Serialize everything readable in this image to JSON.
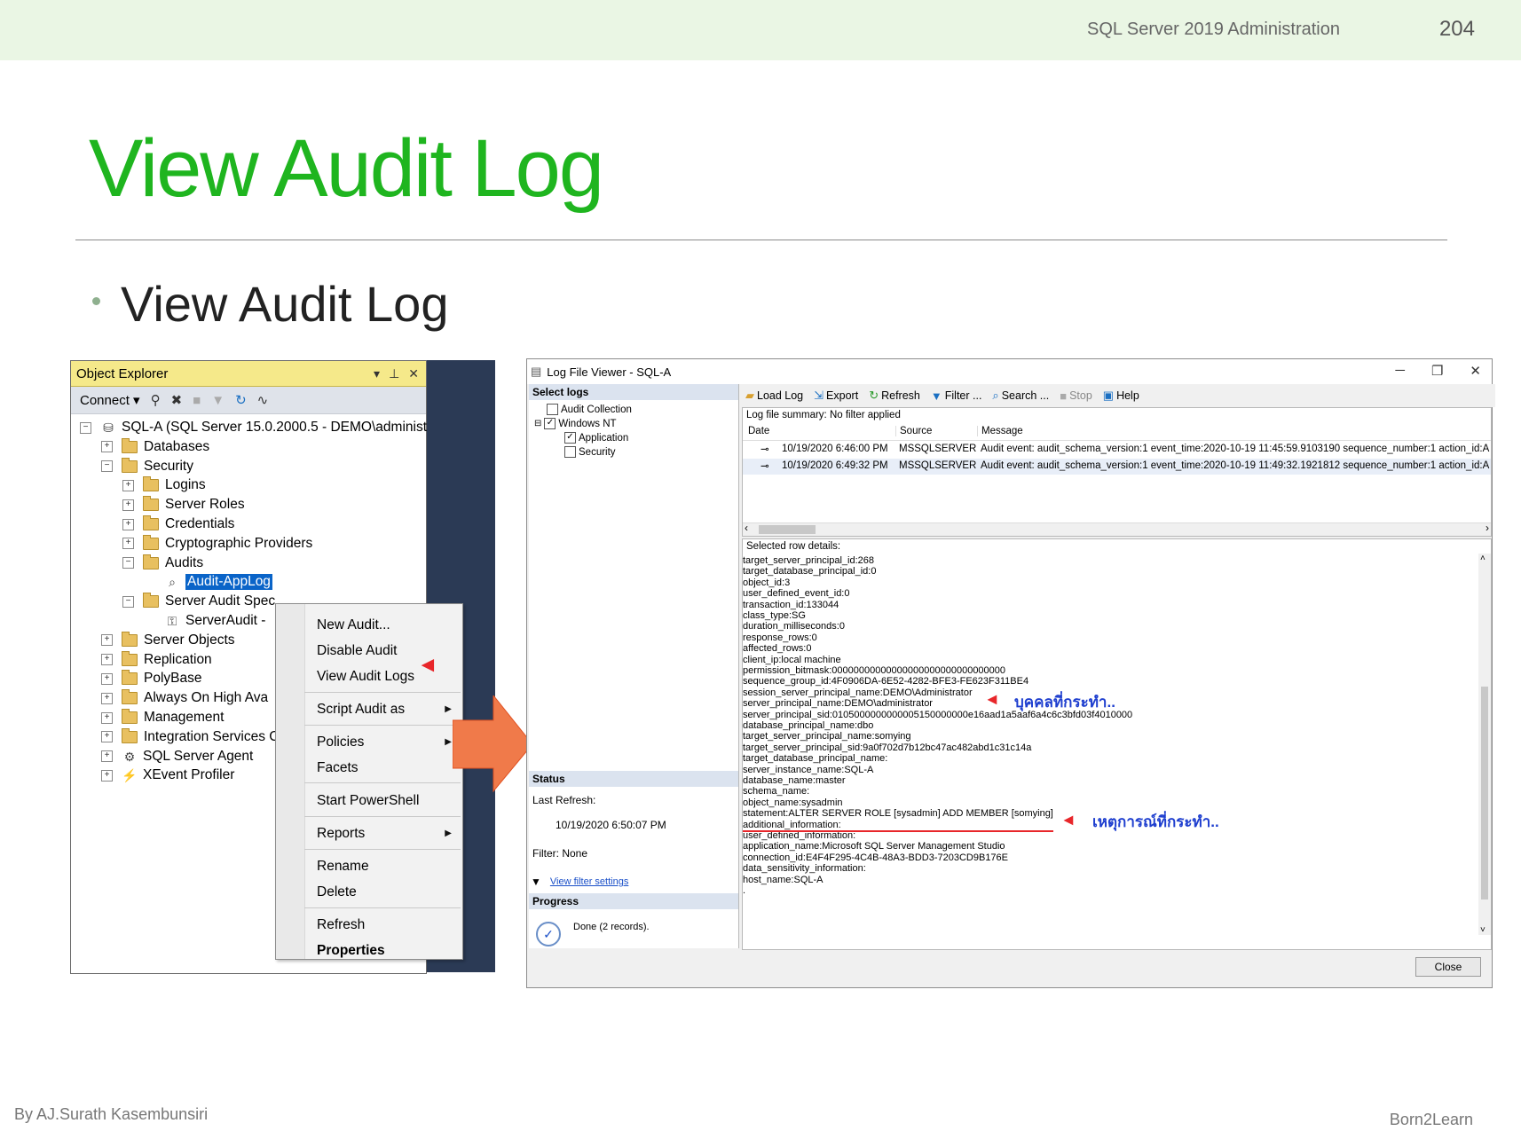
{
  "slide": {
    "course": "SQL Server 2019 Administration",
    "page_number": "204",
    "title": "View Audit Log",
    "bullet": "View Audit Log",
    "author": "By AJ.Surath Kasembunsiri",
    "brand": "Born2Learn"
  },
  "object_explorer": {
    "title": "Object Explorer",
    "connect_label": "Connect ▾",
    "tree": [
      {
        "label": "SQL-A (SQL Server 15.0.2000.5 - DEMO\\administ",
        "exp": "⊟",
        "icon": "server"
      },
      {
        "label": "Databases",
        "exp": "⊞",
        "icon": "folder"
      },
      {
        "label": "Security",
        "exp": "⊟",
        "icon": "folder"
      },
      {
        "label": "Logins",
        "exp": "⊞",
        "icon": "folder"
      },
      {
        "label": "Server Roles",
        "exp": "⊞",
        "icon": "folder"
      },
      {
        "label": "Credentials",
        "exp": "⊞",
        "icon": "folder"
      },
      {
        "label": "Cryptographic Providers",
        "exp": "⊞",
        "icon": "folder"
      },
      {
        "label": "Audits",
        "exp": "⊟",
        "icon": "folder"
      },
      {
        "label": "Audit-AppLog",
        "exp": "",
        "icon": "audit",
        "selected": true
      },
      {
        "label": "Server Audit Spec",
        "exp": "⊟",
        "icon": "folder"
      },
      {
        "label": "ServerAudit -",
        "exp": "",
        "icon": "audit-spec"
      },
      {
        "label": "Server Objects",
        "exp": "⊞",
        "icon": "folder"
      },
      {
        "label": "Replication",
        "exp": "⊞",
        "icon": "folder"
      },
      {
        "label": "PolyBase",
        "exp": "⊞",
        "icon": "folder"
      },
      {
        "label": "Always On High Ava",
        "exp": "⊞",
        "icon": "folder"
      },
      {
        "label": "Management",
        "exp": "⊞",
        "icon": "folder"
      },
      {
        "label": "Integration Services C",
        "exp": "⊞",
        "icon": "folder"
      },
      {
        "label": "SQL Server Agent",
        "exp": "⊞",
        "icon": "agent"
      },
      {
        "label": "XEvent Profiler",
        "exp": "⊞",
        "icon": "profiler"
      }
    ]
  },
  "context_menu": {
    "items": [
      "New Audit...",
      "Disable Audit",
      "View Audit Logs",
      "Script Audit as",
      "Policies",
      "Facets",
      "Start PowerShell",
      "Reports",
      "Rename",
      "Delete",
      "Refresh",
      "Properties"
    ]
  },
  "log_viewer": {
    "title": "Log File Viewer - SQL-A",
    "select_logs_label": "Select logs",
    "log_tree": {
      "audit_collection": "Audit Collection",
      "windows_nt": "Windows NT",
      "application": "Application",
      "security": "Security"
    },
    "toolbar": {
      "load_log": "Load Log",
      "export": "Export",
      "refresh": "Refresh",
      "filter": "Filter ...",
      "search": "Search ...",
      "stop": "Stop",
      "help": "Help"
    },
    "summary": "Log file summary: No filter applied",
    "columns": {
      "date": "Date",
      "source": "Source",
      "message": "Message"
    },
    "rows": [
      {
        "date": "10/19/2020 6:46:00 PM",
        "source": "MSSQLSERVER",
        "message": "Audit event: audit_schema_version:1 event_time:2020-10-19 11:45:59.9103190 sequence_number:1 action_id:A"
      },
      {
        "date": "10/19/2020 6:49:32 PM",
        "source": "MSSQLSERVER",
        "message": "Audit event: audit_schema_version:1 event_time:2020-10-19 11:49:32.1921812 sequence_number:1 action_id:A"
      }
    ],
    "details_label": "Selected row details:",
    "details": [
      "target_server_principal_id:268",
      "target_database_principal_id:0",
      "object_id:3",
      "user_defined_event_id:0",
      "transaction_id:133044",
      "class_type:SG",
      "duration_milliseconds:0",
      "response_rows:0",
      "affected_rows:0",
      "client_ip:local machine",
      "permission_bitmask:00000000000000000000000000000000",
      "sequence_group_id:4F0906DA-6E52-4282-BFE3-FE623F311BE4",
      "session_server_principal_name:DEMO\\Administrator",
      "server_principal_name:DEMO\\administrator",
      "server_principal_sid:0105000000000005150000000e16aad1a5aaf6a4c6c3bfd03f4010000",
      "database_principal_name:dbo",
      "target_server_principal_name:somying",
      "target_server_principal_sid:9a0f702d7b12bc47ac482abd1c31c14a",
      "target_database_principal_name:",
      "server_instance_name:SQL-A",
      "database_name:master",
      "schema_name:",
      "object_name:sysadmin",
      "statement:ALTER SERVER ROLE [sysadmin] ADD MEMBER [somying]",
      "additional_information:",
      "user_defined_information:",
      "application_name:Microsoft SQL Server Management Studio",
      "connection_id:E4F4F295-4C4B-48A3-BDD3-7203CD9B176E",
      "data_sensitivity_information:",
      "host_name:SQL-A",
      "."
    ],
    "annotation_person": "บุคคลที่กระทำ..",
    "annotation_event": "เหตุการณ์ที่กระทำ..",
    "status_label": "Status",
    "last_refresh_label": "Last Refresh:",
    "last_refresh_value": "10/19/2020 6:50:07 PM",
    "filter_label": "Filter: None",
    "view_filter_link": "View filter settings",
    "progress_label": "Progress",
    "progress_value": "Done (2 records).",
    "close_label": "Close"
  }
}
